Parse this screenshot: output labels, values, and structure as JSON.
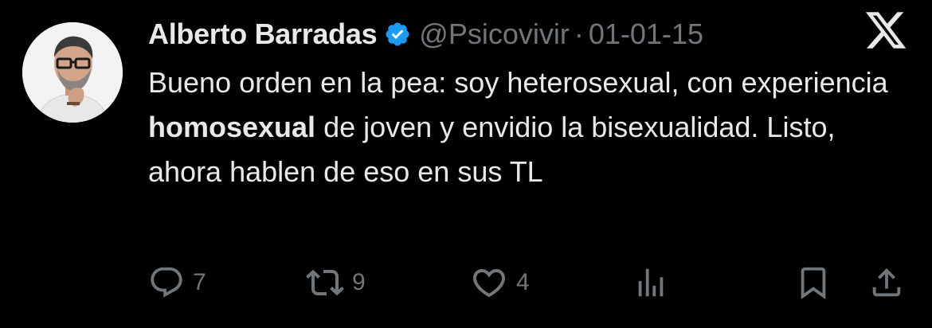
{
  "author": {
    "display_name": "Alberto Barradas",
    "handle": "@Psicovivir",
    "separator": "·",
    "date": "01-01-15",
    "verified_icon": "verified-badge-icon",
    "avatar": "profile-photo"
  },
  "platform": {
    "logo_icon": "x-logo-icon"
  },
  "tweet": {
    "text_part1": "Bueno orden en la pea: soy heterosexual, con experiencia ",
    "text_bold": "homosexual",
    "text_part2": " de joven y envidio la bisexualidad. Listo, ahora hablen de eso en sus TL"
  },
  "actions": {
    "reply": {
      "icon": "reply-icon",
      "count": "7"
    },
    "retweet": {
      "icon": "retweet-icon",
      "count": "9"
    },
    "like": {
      "icon": "heart-icon",
      "count": "4"
    },
    "views": {
      "icon": "views-icon"
    },
    "bookmark": {
      "icon": "bookmark-icon"
    },
    "share": {
      "icon": "share-icon"
    }
  },
  "colors": {
    "background": "#000000",
    "text_primary": "#e7e9ea",
    "text_secondary": "#71767b",
    "verified_blue": "#1d9bf0"
  }
}
